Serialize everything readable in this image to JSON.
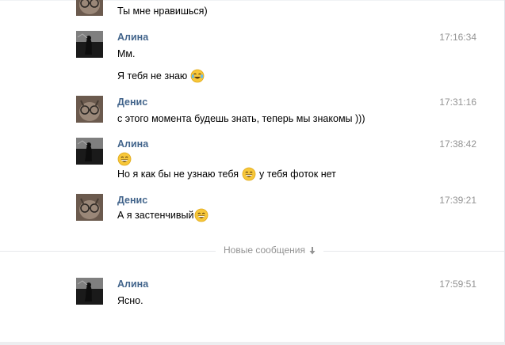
{
  "chat": {
    "messages": [
      {
        "author": "",
        "time": "",
        "lines": [
          "Ты мне нравишься)"
        ]
      },
      {
        "author": "Алина",
        "time": "17:16:34",
        "lines": [
          "Мм.",
          "Я тебя не знаю"
        ]
      },
      {
        "author": "Денис",
        "time": "17:31:16",
        "lines": [
          "с этого момента будешь знать, теперь мы знакомы )))"
        ]
      },
      {
        "author": "Алина",
        "time": "17:38:42",
        "lines": [
          "Но я как бы не узнаю тебя",
          "у тебя фоток нет"
        ]
      },
      {
        "author": "Денис",
        "time": "17:39:21",
        "lines": [
          "А я застенчивый"
        ]
      },
      {
        "author": "Алина",
        "time": "17:59:51",
        "lines": [
          "Ясно."
        ]
      }
    ],
    "new_messages_label": "Новые сообщения"
  },
  "icons": {
    "laugh_tears": "face-with-tears-of-joy-icon",
    "grin": "grinning-face-icon",
    "arrow": "arrow-down-icon"
  },
  "colors": {
    "author_name": "#42648b",
    "timestamp": "#939393",
    "divider": "#e7e8ec",
    "emoji_yellow": "#f7c739"
  }
}
